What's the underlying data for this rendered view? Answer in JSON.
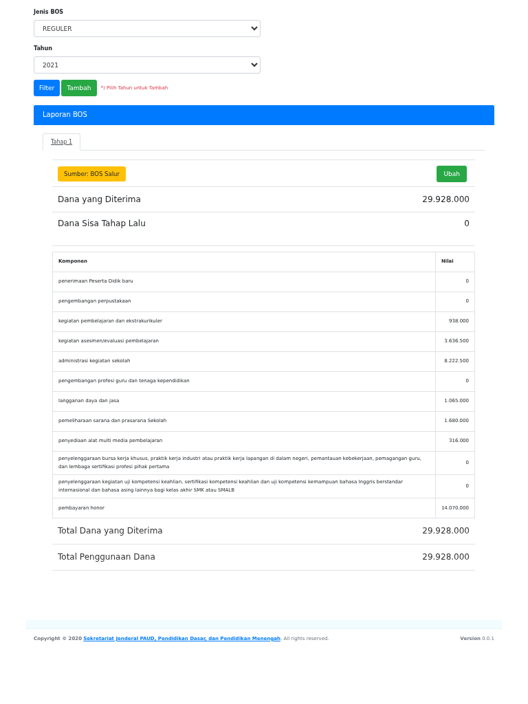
{
  "filters": [
    {
      "label": "Jenis BOS",
      "value": "REGULER"
    },
    {
      "label": "Tahun",
      "value": "2021"
    }
  ],
  "buttons": [
    {
      "label": "Filter",
      "kind": "primary"
    },
    {
      "label": "Tambah",
      "kind": "success"
    }
  ],
  "hint": "*) Pilih Tahun untuk Tambah",
  "card": {
    "title": "Laporan BOS",
    "tabs": [
      {
        "label": "Tahap 1",
        "selected": true
      }
    ],
    "source_badge": "Sumber: BOS Salur",
    "edit_button": "Ubah",
    "summary": [
      {
        "label": "Dana yang Diterima",
        "value": "29.928.000"
      },
      {
        "label": "Dana Sisa Tahap Lalu",
        "value": "0"
      }
    ],
    "table": {
      "columns": [
        "Komponen",
        "Nilai"
      ],
      "rows": [
        [
          "penerimaan Peserta Didik baru",
          "0"
        ],
        [
          "pengembangan perpustakaan",
          "0"
        ],
        [
          "kegiatan pembelajaran dan ekstrakurikuler",
          "938.000"
        ],
        [
          "kegiatan asesmen/evaluasi pembelajaran",
          "3.636.500"
        ],
        [
          "administrasi kegiatan sekolah",
          "8.222.500"
        ],
        [
          "pengembangan profesi guru dan tenaga kependidikan",
          "0"
        ],
        [
          "langganan daya dan jasa",
          "1.065.000"
        ],
        [
          "pemeliharaan sarana dan prasarana Sekolah",
          "1.680.000"
        ],
        [
          "penyediaan alat multi media pembelajaran",
          "316.000"
        ],
        [
          "penyelenggaraan bursa kerja khusus, praktik kerja industri atau praktik kerja lapangan di dalam negeri, pemantauan kebekerjaan, pemagangan guru, dan lembaga sertifikasi profesi pihak pertama",
          "0"
        ],
        [
          "penyelenggaraan kegiatan uji kompetensi keahlian, sertifikasi kompetensi keahlian dan uji kompetensi kemampuan bahasa Inggris berstandar internasional dan bahasa asing lainnya bagi kelas akhir SMK atau SMALB",
          "0"
        ],
        [
          "pembayaran honor",
          "14.070.000"
        ]
      ]
    },
    "totals": [
      {
        "label": "Total Dana yang Diterima",
        "value": "29.928.000"
      },
      {
        "label": "Total Penggunaan Dana",
        "value": "29.928.000"
      }
    ]
  },
  "footer": {
    "copyright": "Copyright © 2020",
    "link": "Sekretariat Jenderal PAUD, Pendidikan Dasar, dan Pendidikan Menengah",
    "suffix": ". All rights reserved.",
    "version": "**Version** 0.0.1"
  }
}
